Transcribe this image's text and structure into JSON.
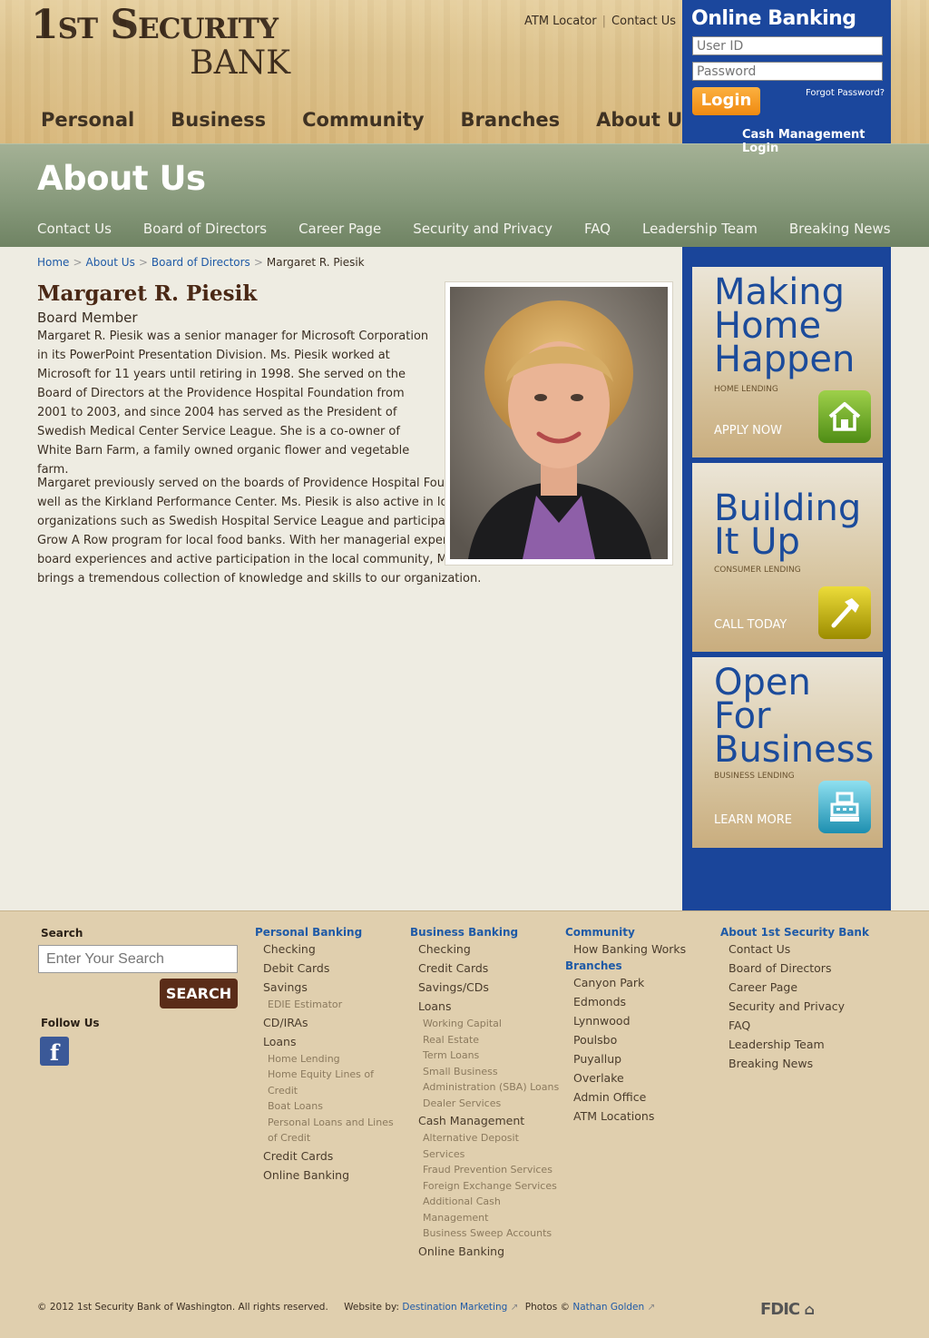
{
  "logo": {
    "line1": "1st Security",
    "line2": "Bank"
  },
  "utility": {
    "atm": "ATM Locator",
    "contact": "Contact Us"
  },
  "main_nav": [
    "Personal",
    "Business",
    "Community",
    "Branches",
    "About Us"
  ],
  "online_banking": {
    "title": "Online Banking",
    "user_placeholder": "User ID",
    "password_placeholder": "Password",
    "login": "Login",
    "forgot": "Forgot Password?",
    "cash_management": "Cash Management Login"
  },
  "banner": {
    "title": "About Us",
    "subnav": [
      "Contact Us",
      "Board of Directors",
      "Career Page",
      "Security and Privacy",
      "FAQ",
      "Leadership Team",
      "Breaking News"
    ]
  },
  "breadcrumb": [
    "Home",
    "About Us",
    "Board of Directors",
    "Margaret R. Piesik"
  ],
  "profile": {
    "name": "Margaret R. Piesik",
    "role": "Board Member",
    "para1": "Margaret R. Piesik was a senior manager for Microsoft Corporation in its PowerPoint Presentation Division. Ms. Piesik worked at Microsoft for 11 years until retiring in 1998. She served on the Board of Directors at the Providence Hospital Foundation from 2001 to 2003, and since 2004 has served as the President of Swedish Medical Center Service League. She is a co-owner of White Barn Farm, a family owned organic flower and vegetable farm.",
    "para2": "Margaret previously served on the boards of Providence Hospital Foundation as well as the Kirkland Performance Center. Ms. Piesik is also active in local organizations such as Swedish Hospital Service League and participates in the Grow A Row program for local food banks. With her managerial expertise, various board experiences and active participation in the local community, Margaret brings a tremendous collection of knowledge and skills to our organization."
  },
  "promos": [
    {
      "title_lines": [
        "Making",
        "Home",
        "Happen"
      ],
      "subtitle": "HOME LENDING",
      "cta": "APPLY NOW",
      "icon": "house-icon",
      "color": "#6aa123"
    },
    {
      "title_lines": [
        "Building",
        "It Up"
      ],
      "subtitle": "CONSUMER LENDING",
      "cta": "CALL TODAY",
      "icon": "hammer-icon",
      "color": "#c9b400"
    },
    {
      "title_lines": [
        "Open",
        "For",
        "Business"
      ],
      "subtitle": "BUSINESS LENDING",
      "cta": "LEARN MORE",
      "icon": "cash-register-icon",
      "color": "#2aa3c2"
    }
  ],
  "footer": {
    "search_label": "Search",
    "search_placeholder": "Enter Your Search",
    "search_button": "SEARCH",
    "follow": "Follow Us",
    "personal": {
      "head": "Personal Banking",
      "items": [
        {
          "t": "Checking",
          "s": false
        },
        {
          "t": "Debit Cards",
          "s": false
        },
        {
          "t": "Savings",
          "s": false
        },
        {
          "t": "EDIE Estimator",
          "s": true
        },
        {
          "t": "CD/IRAs",
          "s": false
        },
        {
          "t": "Loans",
          "s": false
        },
        {
          "t": "Home Lending",
          "s": true
        },
        {
          "t": "Home Equity Lines of Credit",
          "s": true
        },
        {
          "t": "Boat Loans",
          "s": true
        },
        {
          "t": "Personal Loans and Lines of Credit",
          "s": true
        },
        {
          "t": "Credit Cards",
          "s": false
        },
        {
          "t": "Online Banking",
          "s": false
        }
      ]
    },
    "business": {
      "head": "Business Banking",
      "items": [
        {
          "t": "Checking",
          "s": false
        },
        {
          "t": "Credit Cards",
          "s": false
        },
        {
          "t": "Savings/CDs",
          "s": false
        },
        {
          "t": "Loans",
          "s": false
        },
        {
          "t": "Working Capital",
          "s": true
        },
        {
          "t": "Real Estate",
          "s": true
        },
        {
          "t": "Term Loans",
          "s": true
        },
        {
          "t": "Small Business Administration (SBA) Loans",
          "s": true
        },
        {
          "t": "Dealer Services",
          "s": true
        },
        {
          "t": "Cash Management",
          "s": false
        },
        {
          "t": "Alternative Deposit Services",
          "s": true
        },
        {
          "t": "Fraud Prevention Services",
          "s": true
        },
        {
          "t": "Foreign Exchange Services",
          "s": true
        },
        {
          "t": "Additional Cash Management",
          "s": true
        },
        {
          "t": "Business Sweep Accounts",
          "s": true
        },
        {
          "t": "Online Banking",
          "s": false
        }
      ]
    },
    "community": {
      "head": "Community",
      "items": [
        "How Banking Works"
      ]
    },
    "branches": {
      "head": "Branches",
      "items": [
        "Canyon Park",
        "Edmonds",
        "Lynnwood",
        "Poulsbo",
        "Puyallup",
        "Overlake",
        "Admin Office",
        "ATM Locations"
      ]
    },
    "about": {
      "head": "About 1st Security Bank",
      "items": [
        "Contact Us",
        "Board of Directors",
        "Career Page",
        "Security and Privacy",
        "FAQ",
        "Leadership Team",
        "Breaking News"
      ]
    },
    "copyright": "© 2012 1st Security Bank of Washington. All rights reserved.",
    "website_by_label": "Website by:",
    "website_by": "Destination Marketing",
    "photos_label": "Photos ©",
    "photos_by": "Nathan Golden",
    "fdic": "FDIC"
  }
}
